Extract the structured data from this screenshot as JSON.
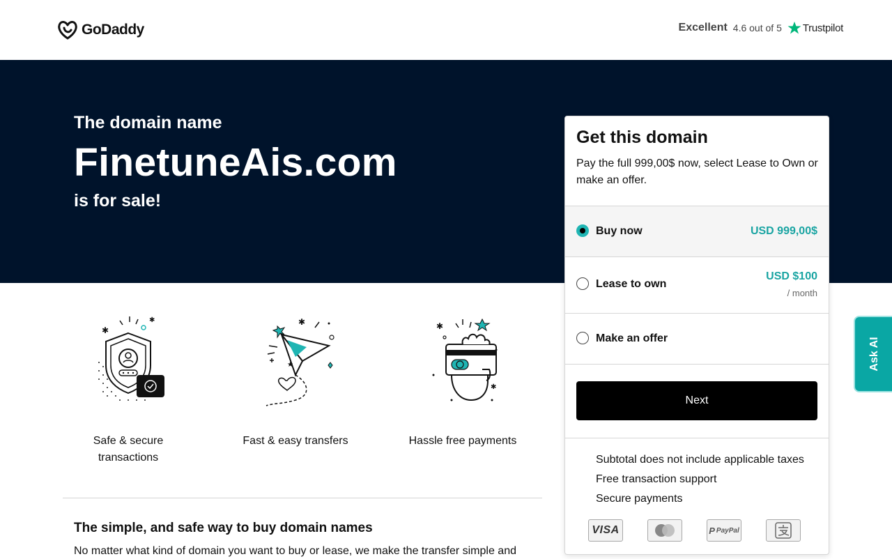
{
  "header": {
    "brand": "GoDaddy",
    "trust_excellent": "Excellent",
    "trust_rating": "4.6 out of 5",
    "trust_brand": "Trustpilot"
  },
  "hero": {
    "pre": "The domain name",
    "domain": "FinetuneAis.com",
    "post": "is for sale!"
  },
  "features": [
    {
      "label": "Safe & secure transactions",
      "icon": "shield-user-icon"
    },
    {
      "label": "Fast & easy transfers",
      "icon": "paper-plane-icon"
    },
    {
      "label": "Hassle free payments",
      "icon": "card-hand-icon"
    }
  ],
  "info": {
    "title": "The simple, and safe way to buy domain names",
    "text": "No matter what kind of domain you want to buy or lease, we make the transfer simple and"
  },
  "card": {
    "title": "Get this domain",
    "desc": "Pay the full 999,00$ now, select Lease to Own or make an offer.",
    "options": {
      "buy": {
        "label": "Buy now",
        "price": "USD 999,00$",
        "selected": true
      },
      "lease": {
        "label": "Lease to own",
        "price": "USD $100",
        "sub": "/ month"
      },
      "offer": {
        "label": "Make an offer"
      }
    },
    "next_label": "Next",
    "features": [
      "Subtotal does not include applicable taxes",
      "Free transaction support",
      "Secure payments"
    ],
    "payments": [
      "visa-icon",
      "mastercard-icon",
      "paypal-icon",
      "alipay-icon"
    ],
    "visa": "VISA",
    "paypal": "PayPal"
  },
  "askai": {
    "label": "Ask AI"
  },
  "colors": {
    "hero_bg": "#00132b",
    "accent": "#1fb5b3",
    "price": "#19a4a2",
    "askai": "#0aa7a4",
    "trustpilot_star": "#00b67a"
  }
}
